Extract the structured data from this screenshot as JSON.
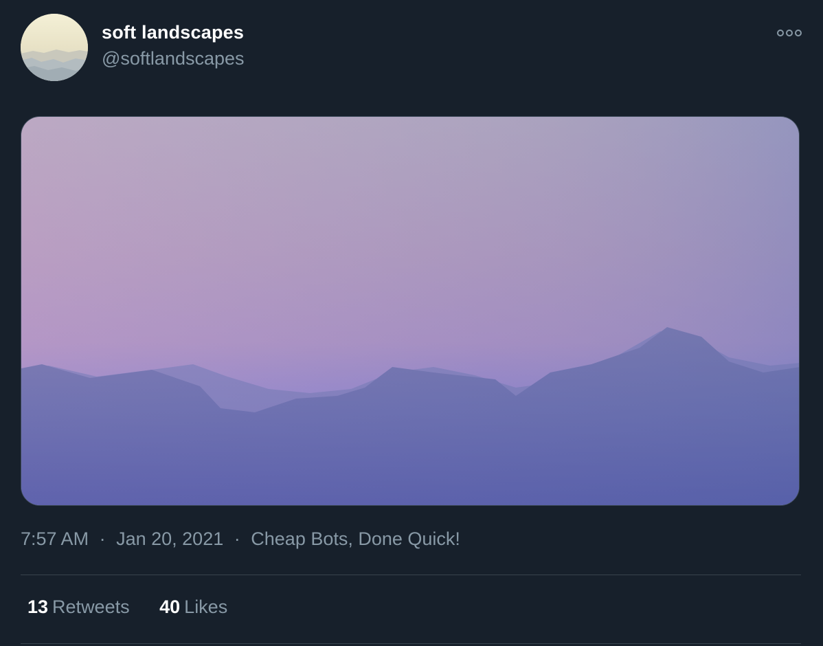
{
  "author": {
    "display_name": "soft landscapes",
    "handle": "@softlandscapes",
    "avatar_icon": "landscape-avatar"
  },
  "menu": {
    "icon": "more-horizontal-icon"
  },
  "media": {
    "kind": "landscape-image",
    "colors": {
      "sky_top": "#cfc0c8",
      "sky_mid": "#c7a6c9",
      "horizon": "#9a8fd6",
      "mountains": "#7f80b6",
      "ground": "#5a60ac"
    }
  },
  "meta": {
    "time": "7:57 AM",
    "separator": "·",
    "date": "Jan 20, 2021",
    "source": "Cheap Bots, Done Quick!"
  },
  "stats": {
    "retweets_count": "13",
    "retweets_label": "Retweets",
    "likes_count": "40",
    "likes_label": "Likes"
  },
  "colors": {
    "background": "#17202b",
    "primary_text": "#ffffff",
    "secondary_text": "#8899a6",
    "divider": "#38444d"
  }
}
